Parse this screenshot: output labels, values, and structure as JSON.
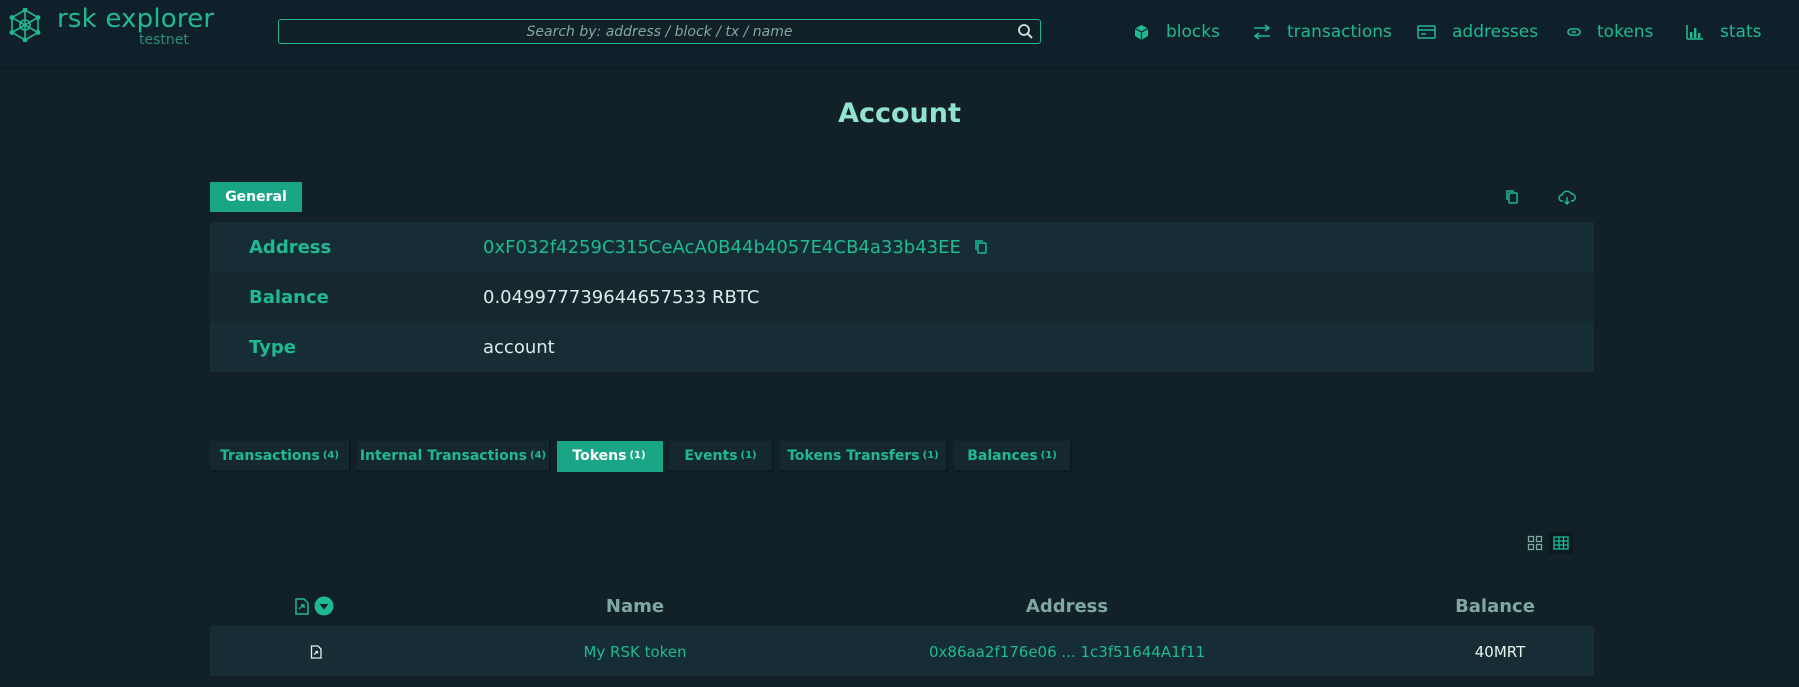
{
  "header": {
    "logo_title": "rsk explorer",
    "logo_network": "testnet",
    "search_placeholder": "Search by: address / block / tx / name",
    "nav": [
      {
        "label": "blocks",
        "icon": "cube-icon"
      },
      {
        "label": "transactions",
        "icon": "arrows-exchange-icon"
      },
      {
        "label": "addresses",
        "icon": "wallet-icon"
      },
      {
        "label": "tokens",
        "icon": "token-icon"
      },
      {
        "label": "stats",
        "icon": "bar-chart-icon"
      }
    ]
  },
  "page": {
    "title": "Account"
  },
  "details_tab": {
    "label": "General",
    "actions": [
      "copy-icon",
      "cloud-download-icon"
    ]
  },
  "details": {
    "address_label": "Address",
    "address_value": "0xF032f4259C315CeAcA0B44b4057E4CB4a33b43EE",
    "balance_label": "Balance",
    "balance_value": "0.049977739644657533 RBTC",
    "type_label": "Type",
    "type_value": "account"
  },
  "subtabs": [
    {
      "label": "Transactions",
      "count": "(4)",
      "active": false
    },
    {
      "label": "Internal Transactions",
      "count": "(4)",
      "active": false
    },
    {
      "label": "Tokens",
      "count": "(1)",
      "active": true
    },
    {
      "label": "Events",
      "count": "(1)",
      "active": false
    },
    {
      "label": "Tokens Transfers",
      "count": "(1)",
      "active": false
    },
    {
      "label": "Balances",
      "count": "(1)",
      "active": false
    }
  ],
  "view_toggle": [
    "grid-view-icon",
    "table-view-icon"
  ],
  "tokens_table": {
    "headers": {
      "name": "Name",
      "address": "Address",
      "balance": "Balance"
    },
    "rows": [
      {
        "name": "My RSK token",
        "address": "0x86aa2f176e06 ... 1c3f51644A1f11",
        "balance": "40MRT"
      }
    ]
  },
  "colors": {
    "accent": "#1fb994",
    "background": "#112127",
    "row": "#172d35",
    "title": "#8fe3cf"
  }
}
